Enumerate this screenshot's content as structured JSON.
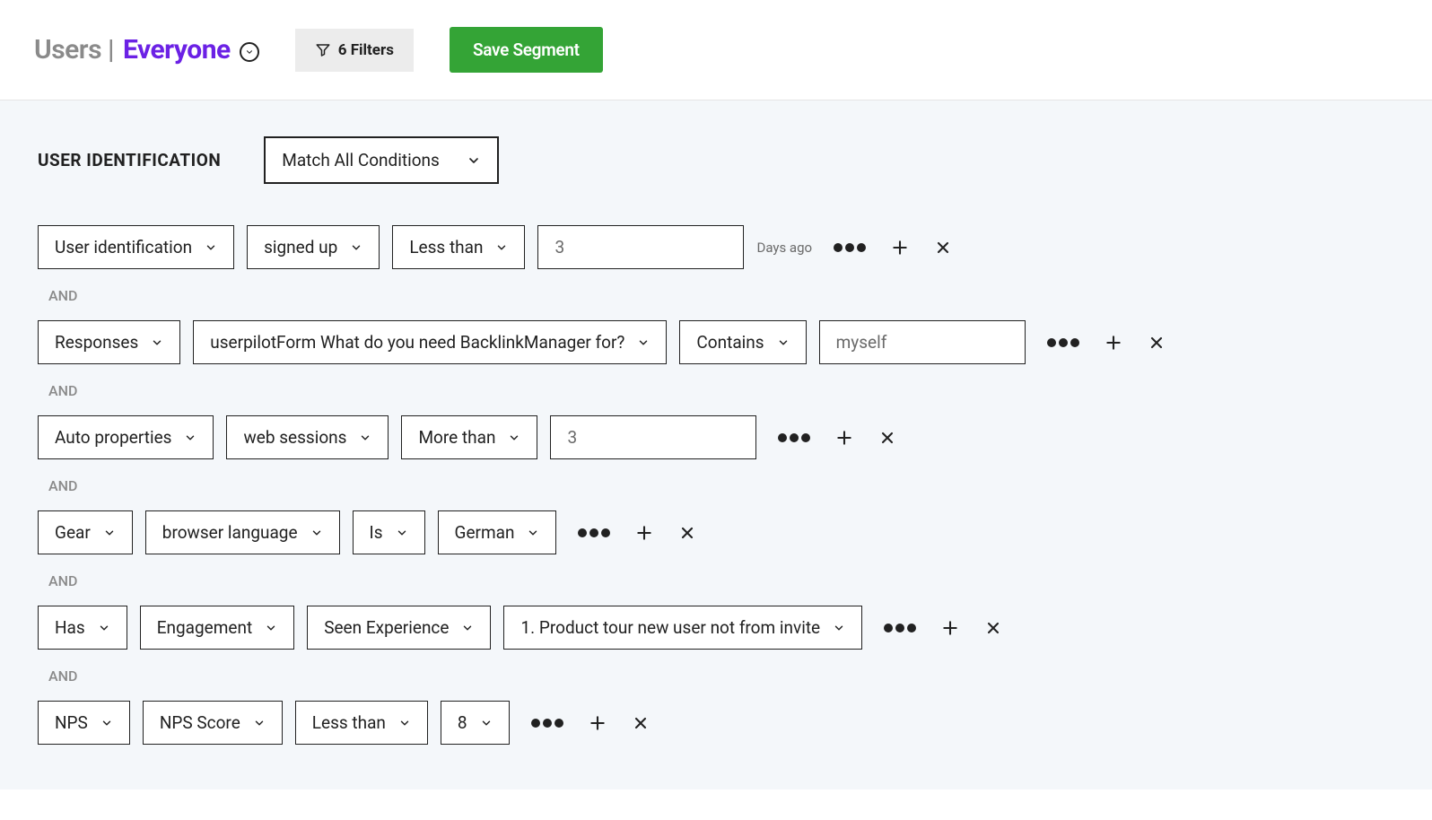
{
  "header": {
    "title_prefix": "Users |",
    "segment_name": "Everyone",
    "filters_label": "6 Filters",
    "save_label": "Save Segment"
  },
  "identification": {
    "section_label": "USER IDENTIFICATION",
    "match_mode": "Match All Conditions"
  },
  "and_label": "AND",
  "rows": [
    {
      "a": "User identification",
      "b": "signed up",
      "c": "Less than",
      "value": "3",
      "suffix": "Days ago"
    },
    {
      "a": "Responses",
      "b": "userpilotForm What do you need BacklinkManager for?",
      "c": "Contains",
      "value": "myself"
    },
    {
      "a": "Auto properties",
      "b": "web sessions",
      "c": "More than",
      "value": "3"
    },
    {
      "a": "Gear",
      "b": "browser language",
      "c": "Is",
      "d": "German"
    },
    {
      "a": "Has",
      "b": "Engagement",
      "c": "Seen Experience",
      "d": "1. Product tour new user not from invite"
    },
    {
      "a": "NPS",
      "b": "NPS Score",
      "c": "Less than",
      "d": "8"
    }
  ]
}
